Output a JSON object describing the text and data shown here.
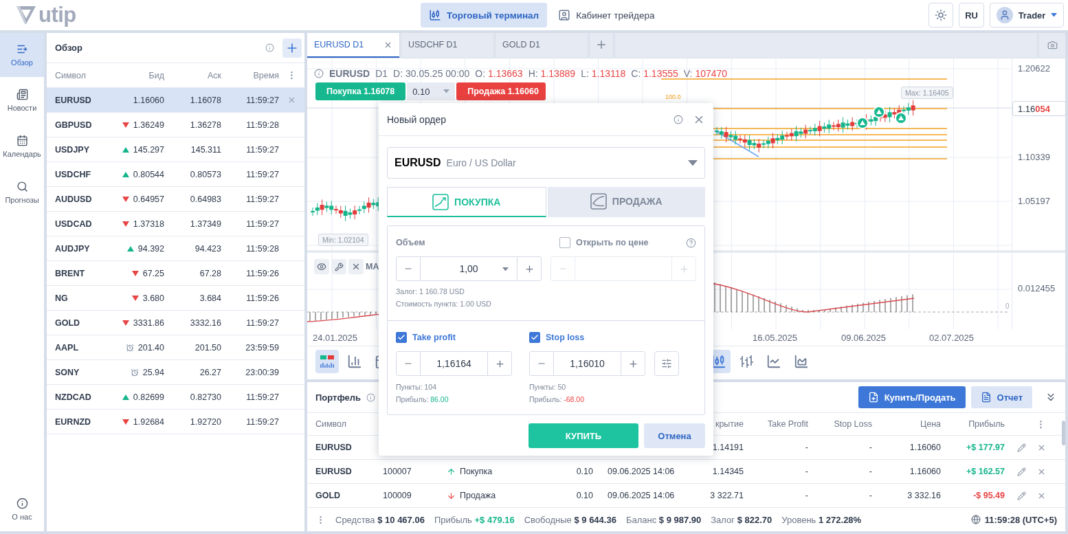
{
  "header": {
    "logo": "utip",
    "nav": [
      {
        "label": "Торговый терминал",
        "selected": true
      },
      {
        "label": "Кабинет трейдера",
        "selected": false
      }
    ],
    "language": "RU",
    "user": "Trader"
  },
  "sidebar": {
    "items": [
      {
        "label": "Обзор",
        "selected": true
      },
      {
        "label": "Новости",
        "selected": false
      },
      {
        "label": "Календарь",
        "selected": false
      },
      {
        "label": "Прогнозы",
        "selected": false
      }
    ],
    "footer_item": {
      "label": "О нас",
      "selected": false
    }
  },
  "watchlist": {
    "title": "Обзор",
    "columns": [
      "Символ",
      "Бид",
      "Аск",
      "Время"
    ],
    "rows": [
      {
        "symbol": "EURUSD",
        "kind": "flat",
        "bid": "1.16060",
        "ask": "1.16078",
        "time": "11:59:27",
        "selected": true
      },
      {
        "symbol": "GBPUSD",
        "kind": "down",
        "bid": "1.36249",
        "ask": "1.36278",
        "time": "11:59:28",
        "selected": false
      },
      {
        "symbol": "USDJPY",
        "kind": "up",
        "bid": "145.297",
        "ask": "145.311",
        "time": "11:59:27",
        "selected": false
      },
      {
        "symbol": "USDCHF",
        "kind": "up",
        "bid": "0.80544",
        "ask": "0.80573",
        "time": "11:59:27",
        "selected": false
      },
      {
        "symbol": "AUDUSD",
        "kind": "down",
        "bid": "0.64957",
        "ask": "0.64983",
        "time": "11:59:27",
        "selected": false
      },
      {
        "symbol": "USDCAD",
        "kind": "down",
        "bid": "1.37318",
        "ask": "1.37349",
        "time": "11:59:27",
        "selected": false
      },
      {
        "symbol": "AUDJPY",
        "kind": "up",
        "bid": "94.392",
        "ask": "94.423",
        "time": "11:59:28",
        "selected": false
      },
      {
        "symbol": "BRENT",
        "kind": "down",
        "bid": "67.25",
        "ask": "67.28",
        "time": "11:59:26",
        "selected": false
      },
      {
        "symbol": "NG",
        "kind": "down",
        "bid": "3.680",
        "ask": "3.684",
        "time": "11:59:26",
        "selected": false
      },
      {
        "symbol": "GOLD",
        "kind": "down",
        "bid": "3331.86",
        "ask": "3332.16",
        "time": "11:59:27",
        "selected": false
      },
      {
        "symbol": "AAPL",
        "kind": "closed",
        "bid": "201.40",
        "ask": "201.50",
        "time": "23:59:59",
        "selected": false
      },
      {
        "symbol": "SONY",
        "kind": "closed",
        "bid": "25.94",
        "ask": "26.27",
        "time": "23:00:39",
        "selected": false
      },
      {
        "symbol": "NZDCAD",
        "kind": "up",
        "bid": "0.82699",
        "ask": "0.82730",
        "time": "11:59:27",
        "selected": false
      },
      {
        "symbol": "EURNZD",
        "kind": "down",
        "bid": "1.92684",
        "ask": "1.92720",
        "time": "11:59:27",
        "selected": false
      }
    ]
  },
  "chart_tabs": [
    {
      "label": "EURUSD D1",
      "selected": true
    },
    {
      "label": "USDCHF D1",
      "selected": false
    },
    {
      "label": "GOLD D1",
      "selected": false
    }
  ],
  "chart": {
    "symbol": "EURUSD",
    "timeframe": "D1",
    "ohlc": [
      {
        "label": "D:",
        "value": "30.05.25 00:00",
        "color": "#6b7587"
      },
      {
        "label": "O:",
        "value": "1.13663",
        "color": "#e84545"
      },
      {
        "label": "H:",
        "value": "1.13889",
        "color": "#e84545"
      },
      {
        "label": "L:",
        "value": "1.13118",
        "color": "#e84545"
      },
      {
        "label": "C:",
        "value": "1.13555",
        "color": "#e84545"
      },
      {
        "label": "V:",
        "value": "107470",
        "color": "#e84545"
      }
    ],
    "buy_button": "Покупка 1.16078",
    "lot": "0.10",
    "sell_button": "Продажа 1.16060",
    "max_label": "Max: 1.16405",
    "min_label": "Min: 1.02104",
    "fib_label": "100.0",
    "price_axis": [
      "1.20622",
      "1.10339",
      "1.05197"
    ],
    "current_price": {
      "main": "1.16",
      "highlight": "054"
    },
    "indicator": {
      "name": "MA",
      "axis_label": "0.012455",
      "zero_label": "0"
    },
    "dates": [
      "24.01.2025",
      "16.05.2025",
      "09.06.2025",
      "02.07.2025"
    ]
  },
  "toolbar": {
    "left": [
      {
        "kind": "candles-volume",
        "selected": true
      },
      {
        "kind": "bars-volume",
        "selected": false
      },
      {
        "kind": "calendar",
        "selected": false
      }
    ],
    "right": [
      {
        "kind": "candles",
        "selected": true
      },
      {
        "kind": "ohlc",
        "selected": false
      },
      {
        "kind": "line",
        "selected": false
      },
      {
        "kind": "area",
        "selected": false
      }
    ]
  },
  "portfolio": {
    "title": "Портфель",
    "buy_sell_button": "Купить/Продать",
    "report_button": "Отчет",
    "headers": {
      "symbol": "Символ",
      "opening": "крытие",
      "take_profit": "Take Profit",
      "stop_loss": "Stop Loss",
      "price": "Цена",
      "profit": "Прибыль"
    },
    "rows": [
      {
        "symbol": "EURUSD",
        "opening": "1.14191",
        "take_profit": "-",
        "stop_loss": "-",
        "price": "1.16060",
        "profit": "+$ 177.97",
        "color": "#16b58c"
      },
      {
        "symbol": "EURUSD",
        "order": "100007",
        "kind": "buy",
        "side_label": "Покупка",
        "volume": "0.10",
        "time": "09.06.2025 14:06",
        "opening": "1.14345",
        "take_profit": "-",
        "stop_loss": "-",
        "price": "1.16060",
        "profit": "+$ 162.57",
        "color": "#16b58c"
      },
      {
        "symbol": "GOLD",
        "order": "100009",
        "kind": "sell",
        "side_label": "Продажа",
        "volume": "0.10",
        "time": "09.06.2025 14:06",
        "opening": "3 322.71",
        "take_profit": "-",
        "stop_loss": "-",
        "price": "3 332.16",
        "profit": "-$ 95.49",
        "color": "#e84545"
      }
    ]
  },
  "status_bar": {
    "items": [
      {
        "label": "Средства",
        "value": "$ 10 467.06",
        "color": "#2f3a4c"
      },
      {
        "label": "Прибыль",
        "value": "+$ 479.16",
        "color": "#16b58c"
      },
      {
        "label": "Свободные",
        "value": "$ 9 644.36",
        "color": "#2f3a4c"
      },
      {
        "label": "Баланс",
        "value": "$ 9 987.90",
        "color": "#2f3a4c"
      },
      {
        "label": "Залог",
        "value": "$ 822.70",
        "color": "#2f3a4c"
      },
      {
        "label": "Уровень",
        "value": "1 272.28%",
        "color": "#2f3a4c"
      }
    ],
    "clock": "11:59:28 (UTC+5)"
  },
  "order_dialog": {
    "title": "Новый ордер",
    "symbol": "EURUSD",
    "description": "Euro / US Dollar",
    "sides": [
      {
        "label": "ПОКУПКА",
        "kind": "buy",
        "selected": true
      },
      {
        "label": "ПРОДАЖА",
        "kind": "sell",
        "selected": false
      }
    ],
    "volume": {
      "label": "Объем",
      "value": "1,00"
    },
    "open_at_price": {
      "label": "Открыть по цене",
      "checked": false
    },
    "margin": "Залог: 1 160.78 USD",
    "pip_value": "Стоимость пункта: 1.00 USD",
    "take_profit": {
      "label": "Take profit",
      "checked": true,
      "value": "1,16164",
      "points": "Пункты: 104",
      "profit_label": "Прибыль:",
      "profit": "86.00",
      "color": "#16b58c"
    },
    "stop_loss": {
      "label": "Stop loss",
      "checked": true,
      "value": "1,16010",
      "points": "Пункты: 50",
      "profit_label": "Прибыль:",
      "profit": "-68.00",
      "color": "#e84545"
    },
    "submit": "КУПИТЬ",
    "cancel": "Отмена"
  }
}
